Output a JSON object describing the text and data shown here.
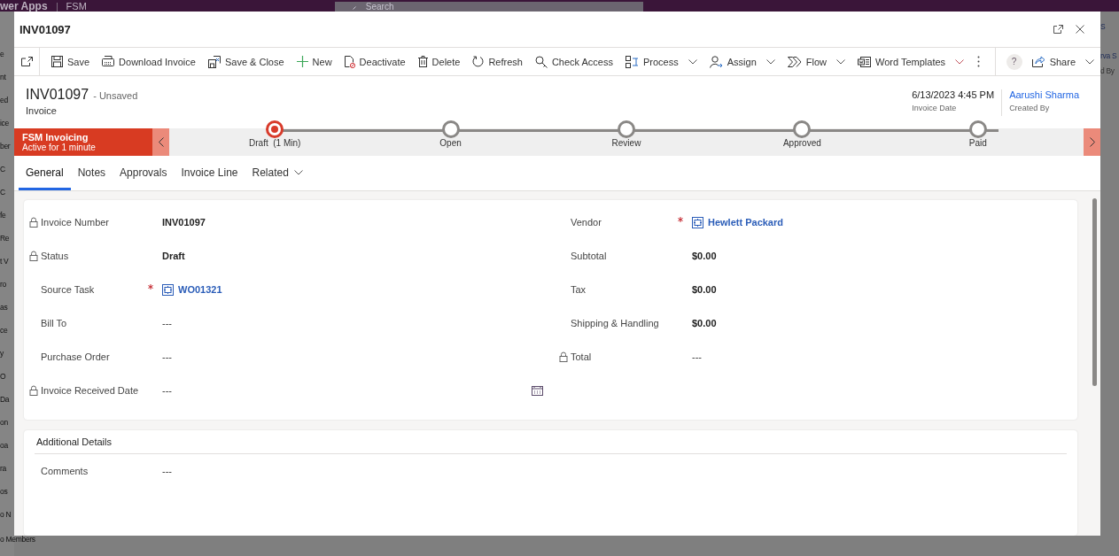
{
  "background": {
    "app_title": "wer Apps",
    "environment": "FSM",
    "search": {
      "placeholder": "Search"
    },
    "sidebar_fragments": [
      "e",
      "nt",
      "ed",
      "ice",
      "ber",
      "C",
      "C",
      "fe",
      "Re",
      "t V",
      "ro",
      "as",
      "ce",
      "y",
      "O",
      "Da",
      "on",
      "oa",
      "ra",
      "os",
      "o N",
      "o Members"
    ],
    "right_fragments": [
      "S",
      "rva S",
      "d By"
    ]
  },
  "window": {
    "title": "INV01097"
  },
  "command_bar": {
    "items": [
      {
        "kind": "save",
        "label": "Save",
        "menu": false
      },
      {
        "kind": "download",
        "label": "Download Invoice",
        "menu": false
      },
      {
        "kind": "save_close",
        "label": "Save & Close",
        "menu": false
      },
      {
        "kind": "new",
        "label": "New",
        "menu": false
      },
      {
        "kind": "deactivate",
        "label": "Deactivate",
        "menu": false
      },
      {
        "kind": "delete",
        "label": "Delete",
        "menu": false
      },
      {
        "kind": "refresh",
        "label": "Refresh",
        "menu": false
      },
      {
        "kind": "check_access",
        "label": "Check Access",
        "menu": false
      },
      {
        "kind": "process",
        "label": "Process",
        "menu": true
      },
      {
        "kind": "assign",
        "label": "Assign",
        "menu": true
      },
      {
        "kind": "flow",
        "label": "Flow",
        "menu": true
      },
      {
        "kind": "word",
        "label": "Word Templates",
        "menu": true
      }
    ],
    "help": "?",
    "share": "Share"
  },
  "record_header": {
    "title": "INV01097",
    "save_state": "- Unsaved",
    "entity": "Invoice",
    "fields": [
      {
        "kind": "text",
        "value": "6/13/2023 4:45 PM",
        "label": "Invoice Date"
      },
      {
        "kind": "link",
        "value": "Aarushi Sharma",
        "label": "Created By"
      }
    ]
  },
  "process_bar": {
    "name": "FSM Invoicing",
    "status": "Active for 1 minute",
    "stages": [
      {
        "label": "Draft  (1 Min)",
        "selected": true
      },
      {
        "label": "Open",
        "selected": false
      },
      {
        "label": "Review",
        "selected": false
      },
      {
        "label": "Approved",
        "selected": false
      },
      {
        "label": "Paid",
        "selected": false
      }
    ]
  },
  "tabs": [
    {
      "label": "General",
      "selected": true,
      "menu": false
    },
    {
      "label": "Notes",
      "selected": false,
      "menu": false
    },
    {
      "label": "Approvals",
      "selected": false,
      "menu": false
    },
    {
      "label": "Invoice Line",
      "selected": false,
      "menu": false
    },
    {
      "label": "Related",
      "selected": false,
      "menu": true
    }
  ],
  "general_section": {
    "left_fields": [
      {
        "label": "Invoice Number",
        "locked": true,
        "required": false,
        "kind": "value",
        "value": "INV01097",
        "calendar": false
      },
      {
        "label": "Status",
        "locked": true,
        "required": false,
        "kind": "value",
        "value": "Draft",
        "calendar": false
      },
      {
        "label": "Source Task",
        "locked": false,
        "required": true,
        "kind": "lookup",
        "value": "WO01321",
        "calendar": false
      },
      {
        "label": "Bill To",
        "locked": false,
        "required": false,
        "kind": "empty",
        "value": "---",
        "calendar": false
      },
      {
        "label": "Purchase Order",
        "locked": false,
        "required": false,
        "kind": "empty",
        "value": "---",
        "calendar": false
      },
      {
        "label": "Invoice Received Date",
        "locked": true,
        "required": false,
        "kind": "empty",
        "value": "---",
        "calendar": true
      }
    ],
    "right_fields": [
      {
        "label": "Vendor",
        "locked": false,
        "required": true,
        "kind": "lookup",
        "value": "Hewlett Packard",
        "calendar": false
      },
      {
        "label": "Subtotal",
        "locked": false,
        "required": false,
        "kind": "value",
        "value": "$0.00",
        "calendar": false
      },
      {
        "label": "Tax",
        "locked": false,
        "required": false,
        "kind": "value",
        "value": "$0.00",
        "calendar": false
      },
      {
        "label": "Shipping & Handling",
        "locked": false,
        "required": false,
        "kind": "value",
        "value": "$0.00",
        "calendar": false
      },
      {
        "label": "Total",
        "locked": true,
        "required": false,
        "kind": "empty",
        "value": "---",
        "calendar": false
      }
    ]
  },
  "additional_section": {
    "title": "Additional Details",
    "fields": [
      {
        "label": "Comments",
        "locked": false,
        "required": false,
        "kind": "empty",
        "value": "---",
        "calendar": false
      }
    ]
  }
}
